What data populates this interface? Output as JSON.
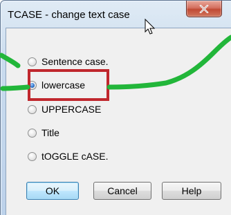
{
  "window": {
    "title": "TCASE - change text case"
  },
  "options": [
    {
      "label": "Sentence case.",
      "checked": false
    },
    {
      "label": "lowercase",
      "checked": true
    },
    {
      "label": "UPPERCASE",
      "checked": false
    },
    {
      "label": "Title",
      "checked": false
    },
    {
      "label": "tOGGLE cASE.",
      "checked": false
    }
  ],
  "buttons": {
    "ok": "OK",
    "cancel": "Cancel",
    "help": "Help"
  },
  "colors": {
    "annotation_line": "#22b63a",
    "highlight_box": "#c0272d",
    "close_button": "#c14a34"
  },
  "icons": {
    "close": "close-icon",
    "cursor": "mouse-pointer-icon"
  }
}
